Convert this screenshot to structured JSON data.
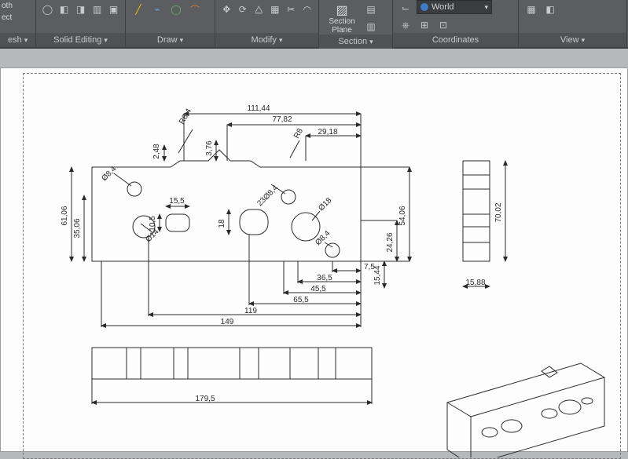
{
  "ribbon": {
    "panels": {
      "mesh": {
        "label_a": "oth",
        "label_b": "ect",
        "panel_label": "esh"
      },
      "solid_editing": {
        "panel_label": "Solid Editing"
      },
      "draw": {
        "panel_label": "Draw"
      },
      "modify": {
        "panel_label": "Modify"
      },
      "section": {
        "big_btn": "Section\nPlane",
        "panel_label": "Section"
      },
      "coordinates": {
        "select_label": "World",
        "panel_label": "Coordinates"
      },
      "view": {
        "panel_label": "View"
      }
    }
  },
  "drawing": {
    "dimensions": {
      "top": {
        "w1": "111,44",
        "w2": "77,82",
        "w3": "29,18",
        "r_left": "R8,4",
        "h_notch": "2,48",
        "h_step": "3,76",
        "r_right": "R8"
      },
      "left": {
        "h_total": "61,06",
        "h_inner": "35,06"
      },
      "holes": {
        "d1": "Ø8,4",
        "d2": "Ø14",
        "d3": "23Ø8,4",
        "d4": "Ø18",
        "d5": "Ø8,4",
        "slot_w": "15,5",
        "slot_h": "10,5",
        "slot_r": "18"
      },
      "right_stack": {
        "h1": "54,06",
        "h2": "24,26",
        "h3": "15,44",
        "h4": "70,02"
      },
      "bottom_stack": {
        "b1": "7,5",
        "b2": "36,5",
        "b3": "45,5",
        "b4": "65,5",
        "b5": "119",
        "b6": "149"
      },
      "side_view": {
        "w": "15,88"
      },
      "bottom_view": {
        "w": "179,5"
      }
    }
  }
}
